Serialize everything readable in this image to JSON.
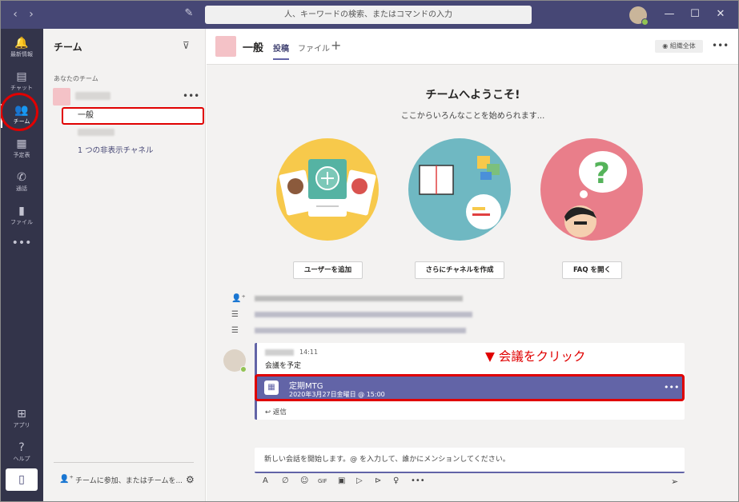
{
  "titlebar": {
    "back_icon": "‹",
    "forward_icon": "›",
    "compose_icon": "✎",
    "search_placeholder": "人、キーワードの検索、またはコマンドの入力",
    "minimize_icon": "—",
    "maximize_icon": "☐",
    "close_icon": "✕"
  },
  "rail": {
    "items": [
      {
        "icon": "🔔",
        "label": "最新情報"
      },
      {
        "icon": "▤",
        "label": "チャット"
      },
      {
        "icon": "👥",
        "label": "チーム"
      },
      {
        "icon": "▦",
        "label": "予定表"
      },
      {
        "icon": "✆",
        "label": "通話"
      },
      {
        "icon": "▮",
        "label": "ファイル"
      },
      {
        "icon": "•••",
        "label": ""
      }
    ],
    "apps": {
      "icon": "⊞",
      "label": "アプリ"
    },
    "help": {
      "icon": "?",
      "label": "ヘルプ"
    },
    "device_icon": "▯"
  },
  "teams_panel": {
    "title": "チーム",
    "filter_icon": "⊽",
    "section_label": "あなたのチーム",
    "more_icon": "•••",
    "channel_general": "一般",
    "hidden_channels": "1 つの非表示チャネル",
    "join_icon": "👤⁺",
    "join_text": "チームに参加、またはチームを...",
    "settings_icon": "⚙"
  },
  "channel_header": {
    "title": "一般",
    "tabs": [
      "投稿",
      "ファイル"
    ],
    "add_tab": "+",
    "org_label": "◉ 組織全体",
    "more_icon": "•••"
  },
  "welcome": {
    "title": "チームへようこそ!",
    "subtitle": "ここからいろんなことを始められます...",
    "buttons": [
      "ユーザーを追加",
      "さらにチャネルを作成",
      "FAQ を開く"
    ],
    "colors": {
      "yellow": "#f7c94b",
      "teal": "#6fb8c2",
      "pink": "#e97e8a"
    }
  },
  "activity_icons": [
    "👤⁺",
    "☰",
    "☰"
  ],
  "message": {
    "time": "14:11",
    "text": "会議を予定",
    "annotation": "▼ 会議をクリック",
    "meeting": {
      "icon": "▦",
      "title": "定期MTG",
      "date": "2020年3月27日金曜日 @ 15:00",
      "more": "•••"
    },
    "reply": "↩ 返信"
  },
  "composer": {
    "placeholder": "新しい会話を開始します。@ を入力して、誰かにメンションしてください。",
    "tools": [
      "A",
      "∅",
      "☺",
      "GIF",
      "▣",
      "▷",
      "⊳",
      "♀",
      "•••"
    ],
    "send_icon": "➢"
  },
  "accent": "#6264a7",
  "highlight": "#e00000"
}
